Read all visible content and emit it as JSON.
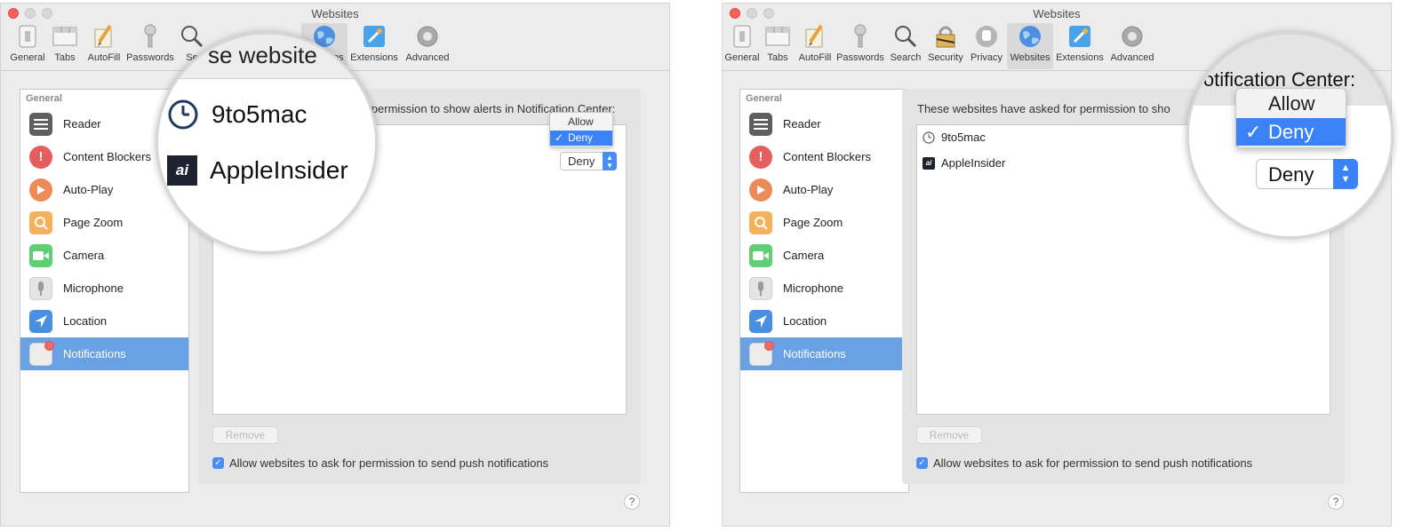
{
  "left": {
    "window_title": "Websites",
    "toolbar": {
      "general": "General",
      "tabs": "Tabs",
      "autofill": "AutoFill",
      "passwords": "Passwords",
      "search_partial": "Se",
      "websites_partial": "ites",
      "extensions": "Extensions",
      "advanced": "Advanced"
    },
    "sidebar": {
      "header": "General",
      "items": [
        {
          "label": "Reader"
        },
        {
          "label": "Content Blockers"
        },
        {
          "label": "Auto-Play"
        },
        {
          "label": "Page Zoom"
        },
        {
          "label": "Camera"
        },
        {
          "label": "Microphone"
        },
        {
          "label": "Location"
        },
        {
          "label": "Notifications"
        }
      ]
    },
    "content": {
      "description_partial": "for permission to show alerts in Notification Center:",
      "popup": {
        "allow": "Allow",
        "deny": "Deny",
        "check": "✓"
      },
      "select_value": "Deny",
      "remove_button": "Remove",
      "checkbox_label": "Allow websites to ask for permission to send push notifications"
    },
    "magnifier": {
      "heading_partial": "se website",
      "site1": "9to5mac",
      "site2": "AppleInsider",
      "site2_icon_text": "ai"
    },
    "help": "?"
  },
  "right": {
    "window_title": "Websites",
    "toolbar": {
      "general": "General",
      "tabs": "Tabs",
      "autofill": "AutoFill",
      "passwords": "Passwords",
      "search": "Search",
      "security": "Security",
      "privacy": "Privacy",
      "websites": "Websites",
      "extensions": "Extensions",
      "advanced": "Advanced"
    },
    "sidebar": {
      "header": "General",
      "items": [
        {
          "label": "Reader"
        },
        {
          "label": "Content Blockers"
        },
        {
          "label": "Auto-Play"
        },
        {
          "label": "Page Zoom"
        },
        {
          "label": "Camera"
        },
        {
          "label": "Microphone"
        },
        {
          "label": "Location"
        },
        {
          "label": "Notifications"
        }
      ]
    },
    "content": {
      "description_partial": "These websites have asked for permission to sho",
      "sites": [
        {
          "name": "9to5mac"
        },
        {
          "name": "AppleInsider",
          "icon_text": "ai"
        }
      ],
      "remove_button": "Remove",
      "checkbox_label": "Allow websites to ask for permission to send push notifications"
    },
    "magnifier": {
      "heading_partial": "Notification Center:",
      "popup": {
        "allow": "Allow",
        "deny": "Deny",
        "check": "✓"
      },
      "select_value": "Deny"
    },
    "help": "?"
  },
  "colors": {
    "selection_blue": "#6aa0e4",
    "accent_blue": "#4a8cf0",
    "close_red": "#fc5f57",
    "badge_red": "#f26a6a"
  }
}
